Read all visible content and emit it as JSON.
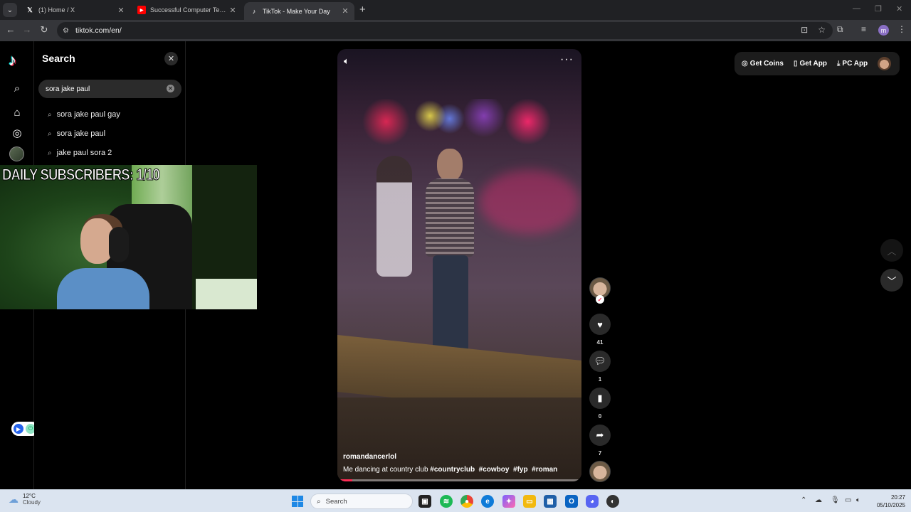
{
  "browser": {
    "tabs": [
      {
        "title": "(1) Home / X",
        "icon": "x-logo-icon"
      },
      {
        "title": "Successful Computer Tech Sho",
        "icon": "youtube-icon"
      },
      {
        "title": "TikTok - Make Your Day",
        "icon": "tiktok-icon",
        "active": true
      }
    ],
    "url": "tiktok.com/en/"
  },
  "tiktok": {
    "search": {
      "title": "Search",
      "query": "sora jake paul",
      "suggestions": [
        "sora jake paul gay",
        "sora jake paul",
        "jake paul sora 2"
      ]
    },
    "topbar": {
      "get_coins": "Get Coins",
      "get_app": "Get App",
      "pc_app": "PC App"
    },
    "video": {
      "username": "romandancerlol",
      "caption": "Me dancing at country club",
      "hashtags": [
        "#countryclub",
        "#cowboy",
        "#fyp",
        "#roman"
      ],
      "progress": 0.06
    },
    "actions": {
      "likes": "41",
      "comments": "1",
      "saves": "0",
      "shares": "7"
    }
  },
  "overlay": {
    "text": "DAILY SUBSCRIBERS: 1/10"
  },
  "taskbar": {
    "weather_temp": "12°C",
    "weather_desc": "Cloudy",
    "search_label": "Search",
    "time": "20:27",
    "date": "05/10/2025"
  },
  "colors": {
    "tiktok_red": "#fe2c55",
    "tiktok_cyan": "#25f4ee",
    "windows_blue": "#1e88e5"
  }
}
